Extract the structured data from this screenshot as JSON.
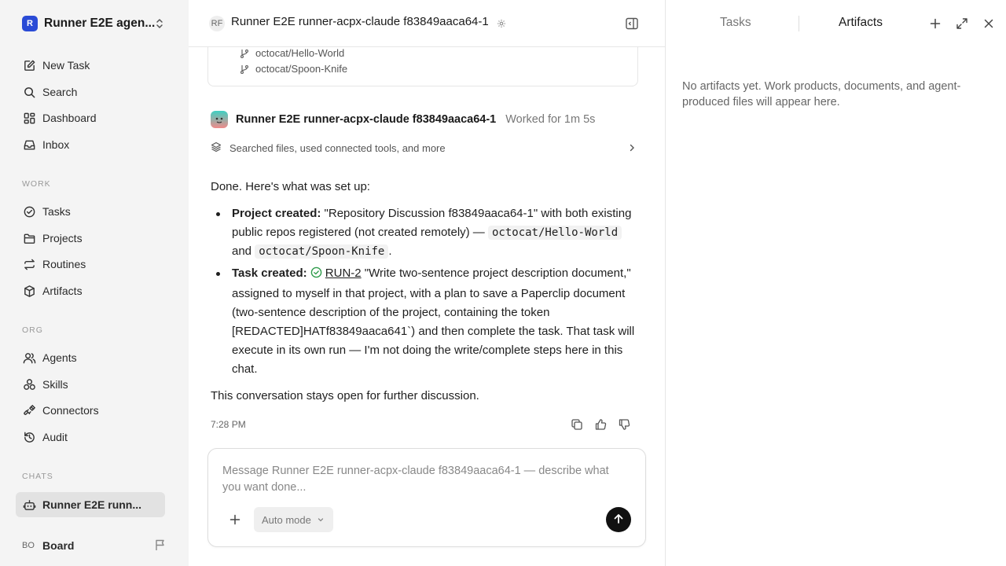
{
  "workspace": {
    "logo_letter": "R",
    "name": "Runner E2E agen..."
  },
  "nav_primary": [
    {
      "label": "New Task",
      "icon": "edit-icon"
    },
    {
      "label": "Search",
      "icon": "search-icon"
    },
    {
      "label": "Dashboard",
      "icon": "dashboard-icon"
    },
    {
      "label": "Inbox",
      "icon": "inbox-icon"
    }
  ],
  "sections": {
    "work": "WORK",
    "org": "ORG",
    "chats": "CHATS"
  },
  "nav_work": [
    {
      "label": "Tasks",
      "icon": "check-circle-icon"
    },
    {
      "label": "Projects",
      "icon": "folder-icon"
    },
    {
      "label": "Routines",
      "icon": "repeat-icon"
    },
    {
      "label": "Artifacts",
      "icon": "box-icon"
    }
  ],
  "nav_org": [
    {
      "label": "Agents",
      "icon": "users-icon"
    },
    {
      "label": "Skills",
      "icon": "skills-icon"
    },
    {
      "label": "Connectors",
      "icon": "plug-icon"
    },
    {
      "label": "Audit",
      "icon": "history-icon"
    }
  ],
  "chats": [
    {
      "label": "Runner E2E runn...",
      "icon": "bot-icon",
      "active": true
    }
  ],
  "board": {
    "initials": "BO",
    "label": "Board"
  },
  "header": {
    "initials": "RF",
    "title": "Runner E2E runner-acpx-claude f83849aaca64-1"
  },
  "repos": [
    "octocat/Hello-World",
    "octocat/Spoon-Knife"
  ],
  "agent": {
    "name": "Runner E2E runner-acpx-claude f83849aaca64-1",
    "worked": "Worked for 1m 5s"
  },
  "tools_summary": "Searched files, used connected tools, and more",
  "message": {
    "intro": "Done. Here's what was set up:",
    "b1_label": "Project created:",
    "b1_text": " \"Repository Discussion f83849aaca64-1\" with both existing public repos registered (not created remotely) — ",
    "b1_code1": "octocat/Hello-World",
    "b1_and": " and ",
    "b1_code2": "octocat/Spoon-Knife",
    "b1_end": ".",
    "b2_label": "Task created:",
    "b2_link": "RUN-2",
    "b2_text": " \"Write two-sentence project description document,\" assigned to myself in that project, with a plan to save a Paperclip document (two-sentence description of the project, containing the token [REDACTED]HATf83849aaca641`) and then complete the task. That task will execute in its own run — I'm not doing the write/complete steps here in this chat.",
    "outro": "This conversation stays open for further discussion."
  },
  "timestamp": "7:28 PM",
  "composer": {
    "placeholder": "Message Runner E2E runner-acpx-claude f83849aaca64-1 — describe what you want done...",
    "mode": "Auto mode"
  },
  "right_panel": {
    "tab_tasks": "Tasks",
    "tab_artifacts": "Artifacts",
    "active_tab": "Artifacts",
    "empty_text": "No artifacts yet. Work products, documents, and agent-produced files will appear here."
  }
}
